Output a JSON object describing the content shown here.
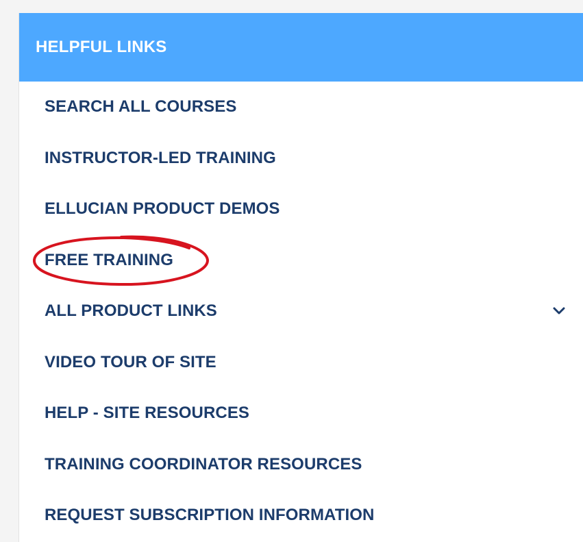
{
  "panel": {
    "title": "HELPFUL LINKS",
    "header_color": "#4da8ff",
    "link_color": "#1c3c6b"
  },
  "links": [
    {
      "label": "SEARCH ALL COURSES"
    },
    {
      "label": "INSTRUCTOR-LED TRAINING"
    },
    {
      "label": "ELLUCIAN PRODUCT DEMOS"
    },
    {
      "label": "FREE TRAINING",
      "annotation": "red-circle-highlight",
      "annotation_color": "#d7141f"
    },
    {
      "label": "ALL PRODUCT LINKS",
      "icon": "chevron-down-icon"
    },
    {
      "label": "VIDEO TOUR OF SITE"
    },
    {
      "label": "HELP - SITE RESOURCES"
    },
    {
      "label": "TRAINING COORDINATOR RESOURCES"
    },
    {
      "label": "REQUEST SUBSCRIPTION INFORMATION"
    }
  ]
}
